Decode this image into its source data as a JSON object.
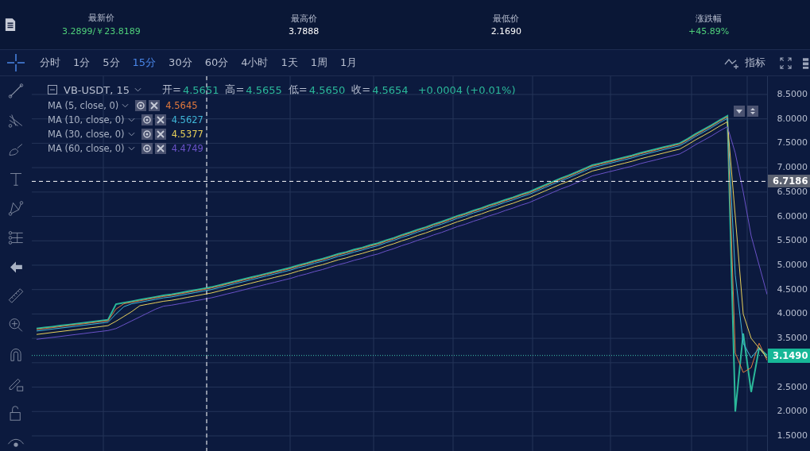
{
  "stats": [
    {
      "label": "最新价",
      "value": "3.2899/￥23.8189",
      "positive": true
    },
    {
      "label": "最高价",
      "value": "3.7888",
      "positive": false
    },
    {
      "label": "最低价",
      "value": "2.1690",
      "positive": false
    },
    {
      "label": "涨跌幅",
      "value": "+45.89%",
      "positive": true
    }
  ],
  "intervals": [
    {
      "label": "分时",
      "selected": false
    },
    {
      "label": "1分",
      "selected": false
    },
    {
      "label": "5分",
      "selected": false
    },
    {
      "label": "15分",
      "selected": true
    },
    {
      "label": "30分",
      "selected": false
    },
    {
      "label": "60分",
      "selected": false
    },
    {
      "label": "4小时",
      "selected": false
    },
    {
      "label": "1天",
      "selected": false
    },
    {
      "label": "1周",
      "selected": false
    },
    {
      "label": "1月",
      "selected": false
    }
  ],
  "indicator_button": "指标",
  "legend": {
    "symbol": "VB-USDT, 15",
    "ohlc": [
      {
        "label": "开=",
        "value": "4.5651"
      },
      {
        "label": "高=",
        "value": "4.5655"
      },
      {
        "label": "低=",
        "value": "4.5650"
      },
      {
        "label": "收=",
        "value": "4.5654"
      }
    ],
    "change": "+0.0004 (+0.01%)"
  },
  "moving_averages": [
    {
      "label": "MA (5, close, 0)",
      "value": "4.5645"
    },
    {
      "label": "MA (10, close, 0)",
      "value": "4.5627"
    },
    {
      "label": "MA (30, close, 0)",
      "value": "4.5377"
    },
    {
      "label": "MA (60, close, 0)",
      "value": "4.4749"
    }
  ],
  "chart": {
    "chart_data": {
      "type": "line",
      "grid": true,
      "ylim": [
        1.174,
        8.874
      ],
      "ref_lines": [
        {
          "axis": "y",
          "value": 6.7186,
          "label": "6.7186",
          "color": "#ffffff"
        },
        {
          "axis": "y",
          "value": 3.149,
          "label": "3.1490",
          "color": "#3fc9b0"
        }
      ],
      "categories": [
        null,
        null,
        null,
        null,
        null,
        null,
        null,
        null,
        null,
        null,
        null,
        null,
        null,
        null,
        null,
        null,
        null,
        null,
        null,
        null,
        null,
        null,
        null,
        null,
        null,
        null,
        null,
        null,
        null,
        null,
        null,
        null,
        null,
        null,
        null,
        null,
        null,
        null,
        null,
        null,
        null,
        null,
        null,
        null,
        null,
        null,
        null,
        null,
        null,
        null,
        null,
        null,
        null,
        null,
        null,
        null,
        null,
        null,
        null,
        null,
        null,
        null,
        null,
        null,
        null,
        null,
        null,
        null,
        null,
        null,
        null,
        null,
        null,
        null,
        null,
        null,
        null,
        null,
        null,
        null,
        null,
        null,
        null,
        null,
        null,
        null,
        null,
        null,
        null,
        null,
        null,
        null,
        null
      ],
      "yticks": [
        {
          "value": 8.5,
          "label": "8.5000"
        },
        {
          "value": 8,
          "label": "8.0000"
        },
        {
          "value": 7.5,
          "label": "7.5000"
        },
        {
          "value": 7,
          "label": "7.0000"
        },
        {
          "value": 6.5,
          "label": "6.5000"
        },
        {
          "value": 6,
          "label": "6.0000"
        },
        {
          "value": 5.5,
          "label": "5.5000"
        },
        {
          "value": 5,
          "label": "5.0000"
        },
        {
          "value": 4.5,
          "label": "4.5000"
        },
        {
          "value": 4,
          "label": "4.0000"
        },
        {
          "value": 3.5,
          "label": "3.5000"
        },
        {
          "value": 2.5,
          "label": "2.5000"
        },
        {
          "value": 2,
          "label": "2.0000"
        },
        {
          "value": 1.5,
          "label": "1.5000"
        }
      ],
      "series": [
        {
          "color": "#2bb89a",
          "values": [
            3.7,
            3.72,
            3.74,
            3.76,
            3.78,
            3.8,
            3.82,
            3.84,
            3.86,
            3.88,
            4.2,
            4.23,
            4.26,
            4.29,
            4.32,
            4.35,
            4.38,
            4.4,
            4.43,
            4.46,
            4.49,
            4.52,
            4.55,
            4.59,
            4.63,
            4.67,
            4.71,
            4.75,
            4.79,
            4.83,
            4.87,
            4.91,
            4.95,
            5.0,
            5.04,
            5.09,
            5.13,
            5.18,
            5.23,
            5.27,
            5.32,
            5.36,
            5.41,
            5.45,
            5.51,
            5.56,
            5.62,
            5.67,
            5.73,
            5.78,
            5.84,
            5.89,
            5.95,
            6.01,
            6.06,
            6.12,
            6.17,
            6.23,
            6.28,
            6.34,
            6.39,
            6.45,
            6.5,
            6.57,
            6.64,
            6.71,
            6.78,
            6.84,
            6.91,
            6.98,
            7.05,
            7.09,
            7.13,
            7.17,
            7.21,
            7.25,
            7.3,
            7.34,
            7.38,
            7.42,
            7.46,
            7.5,
            7.59,
            7.69,
            7.78,
            7.87,
            7.97,
            8.06,
            2.0,
            3.6,
            2.4,
            3.3,
            3.15
          ]
        },
        {
          "color": "#e0783c",
          "values": [
            3.68,
            3.7,
            3.72,
            3.74,
            3.76,
            3.78,
            3.8,
            3.82,
            3.84,
            3.86,
            4.1,
            4.21,
            4.24,
            4.27,
            4.3,
            4.33,
            4.36,
            4.38,
            4.41,
            4.44,
            4.47,
            4.5,
            4.53,
            4.57,
            4.61,
            4.65,
            4.69,
            4.73,
            4.77,
            4.81,
            4.85,
            4.89,
            4.93,
            4.98,
            5.02,
            5.07,
            5.11,
            5.16,
            5.21,
            5.25,
            5.3,
            5.34,
            5.39,
            5.43,
            5.49,
            5.54,
            5.6,
            5.65,
            5.71,
            5.76,
            5.82,
            5.87,
            5.93,
            5.99,
            6.04,
            6.1,
            6.15,
            6.21,
            6.26,
            6.32,
            6.37,
            6.43,
            6.48,
            6.55,
            6.62,
            6.69,
            6.76,
            6.82,
            6.89,
            6.96,
            7.03,
            7.07,
            7.11,
            7.15,
            7.19,
            7.23,
            7.28,
            7.32,
            7.36,
            7.4,
            7.44,
            7.48,
            7.57,
            7.67,
            7.76,
            7.85,
            7.95,
            8.04,
            3.2,
            2.8,
            2.9,
            3.4,
            3.05
          ]
        },
        {
          "color": "#3fb6d8",
          "values": [
            3.65,
            3.67,
            3.69,
            3.71,
            3.73,
            3.75,
            3.77,
            3.79,
            3.81,
            3.83,
            4.0,
            4.15,
            4.21,
            4.24,
            4.27,
            4.3,
            4.33,
            4.35,
            4.38,
            4.41,
            4.44,
            4.47,
            4.5,
            4.54,
            4.58,
            4.62,
            4.66,
            4.7,
            4.74,
            4.78,
            4.82,
            4.86,
            4.9,
            4.95,
            4.99,
            5.04,
            5.08,
            5.13,
            5.18,
            5.22,
            5.27,
            5.31,
            5.36,
            5.4,
            5.46,
            5.51,
            5.57,
            5.62,
            5.68,
            5.73,
            5.79,
            5.84,
            5.9,
            5.96,
            6.01,
            6.07,
            6.12,
            6.18,
            6.23,
            6.29,
            6.34,
            6.4,
            6.45,
            6.52,
            6.59,
            6.66,
            6.73,
            6.79,
            6.86,
            6.93,
            7.0,
            7.04,
            7.08,
            7.12,
            7.16,
            7.2,
            7.25,
            7.29,
            7.33,
            7.37,
            7.41,
            7.45,
            7.54,
            7.64,
            7.73,
            7.82,
            7.92,
            8.01,
            4.8,
            3.4,
            3.1,
            3.3,
            3.1
          ]
        },
        {
          "color": "#e8d05a",
          "values": [
            3.58,
            3.6,
            3.62,
            3.64,
            3.66,
            3.68,
            3.7,
            3.72,
            3.74,
            3.76,
            3.85,
            3.95,
            4.05,
            4.17,
            4.2,
            4.23,
            4.26,
            4.28,
            4.31,
            4.34,
            4.37,
            4.4,
            4.43,
            4.47,
            4.51,
            4.55,
            4.59,
            4.63,
            4.67,
            4.71,
            4.75,
            4.79,
            4.83,
            4.88,
            4.92,
            4.97,
            5.01,
            5.06,
            5.11,
            5.15,
            5.2,
            5.24,
            5.29,
            5.33,
            5.39,
            5.44,
            5.5,
            5.55,
            5.61,
            5.66,
            5.72,
            5.77,
            5.83,
            5.89,
            5.94,
            6.0,
            6.05,
            6.11,
            6.16,
            6.22,
            6.27,
            6.33,
            6.38,
            6.45,
            6.52,
            6.59,
            6.66,
            6.72,
            6.79,
            6.86,
            6.93,
            6.97,
            7.01,
            7.05,
            7.09,
            7.13,
            7.18,
            7.22,
            7.26,
            7.3,
            7.34,
            7.38,
            7.47,
            7.57,
            7.66,
            7.75,
            7.85,
            7.94,
            6.0,
            4.0,
            3.5,
            3.3,
            3.1
          ]
        },
        {
          "color": "#6a52c8",
          "values": [
            3.48,
            3.5,
            3.52,
            3.54,
            3.56,
            3.58,
            3.6,
            3.62,
            3.64,
            3.66,
            3.7,
            3.78,
            3.86,
            3.94,
            4.02,
            4.1,
            4.16,
            4.18,
            4.21,
            4.24,
            4.27,
            4.3,
            4.33,
            4.37,
            4.41,
            4.45,
            4.49,
            4.53,
            4.57,
            4.61,
            4.65,
            4.69,
            4.73,
            4.78,
            4.82,
            4.87,
            4.91,
            4.96,
            5.01,
            5.05,
            5.1,
            5.14,
            5.19,
            5.23,
            5.29,
            5.34,
            5.4,
            5.45,
            5.51,
            5.56,
            5.62,
            5.67,
            5.73,
            5.79,
            5.84,
            5.9,
            5.95,
            6.01,
            6.06,
            6.12,
            6.17,
            6.23,
            6.28,
            6.35,
            6.42,
            6.49,
            6.56,
            6.62,
            6.69,
            6.76,
            6.83,
            6.87,
            6.91,
            6.95,
            6.99,
            7.03,
            7.08,
            7.12,
            7.16,
            7.2,
            7.24,
            7.28,
            7.37,
            7.47,
            7.56,
            7.65,
            7.75,
            7.84,
            7.3,
            6.5,
            5.6,
            5.0,
            4.4
          ]
        }
      ]
    }
  }
}
